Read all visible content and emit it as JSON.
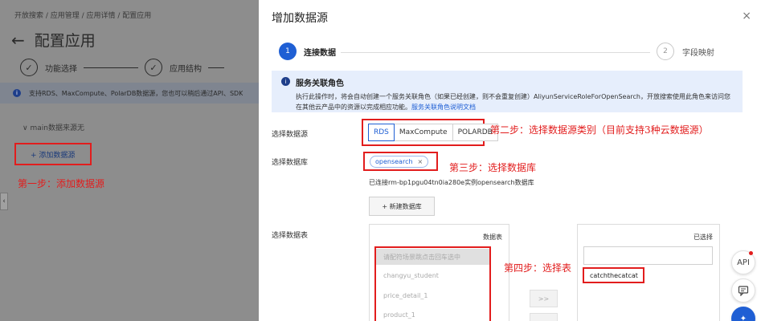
{
  "background": {
    "breadcrumb": "开放搜索  /  应用管理  /  应用详情  /  配置应用",
    "page_title": "配置应用",
    "steps": [
      {
        "label": "功能选择"
      },
      {
        "label": "应用结构"
      }
    ],
    "info_text": "支持RDS、MaxCompute、PolarDB数据源，您也可以稍后通过API、SDK",
    "main_datasource": "main数据来源无",
    "add_datasource_label": "+ 添加数据源"
  },
  "annotations": {
    "step1": "第一步：添加数据源",
    "step2": "第二步：选择数据源类别（目前支持3种云数据源）",
    "step3": "第三步：选择数据库",
    "step4": "第四步：选择表"
  },
  "drawer": {
    "title": "增加数据源",
    "close_icon": "×",
    "steps": [
      {
        "num": "1",
        "label": "连接数据"
      },
      {
        "num": "2",
        "label": "字段映射"
      }
    ],
    "notice": {
      "title": "服务关联角色",
      "body": "执行此操作时，将会自动创建一个服务关联角色（如果已经创建，则不会重复创建）AliyunServiceRoleForOpenSearch，开放搜索使用此角色来访问您在其他云产品中的资源以完成相应功能。",
      "link": "服务关联角色说明文档"
    },
    "datasource_type_label": "选择数据源",
    "datasource_types": [
      "RDS",
      "MaxCompute",
      "POLARDB"
    ],
    "database_label": "选择数据库",
    "database_tag": "opensearch",
    "connected_text": "已连接rm-bp1pgu04tn0ia280e实例opensearch数据库",
    "new_db_button": "+ 新建数据库",
    "table_label": "选择数据表",
    "table_panel_header": "数据表",
    "table_items": [
      "请配符场景跳点击回车选中",
      "changyu_student",
      "price_detail_1",
      "product_1"
    ],
    "transfer_right": ">>",
    "selected_header": "已选择",
    "selected_item": "catchthecatcat",
    "fab_api": "API"
  }
}
